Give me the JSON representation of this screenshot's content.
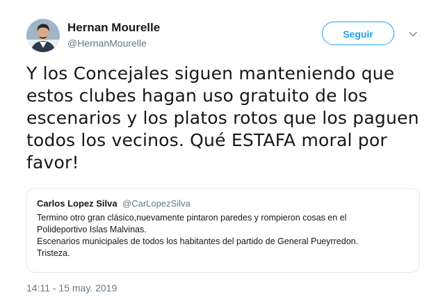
{
  "author": {
    "name": "Hernan Mourelle",
    "handle": "@HernanMourelle",
    "avatar_icon": "profile-photo"
  },
  "follow_button": {
    "label": "Seguir",
    "color": "#1da1f2"
  },
  "menu_icon": "chevron-down-icon",
  "tweet": {
    "text": "Y los Concejales siguen manteniendo que estos clubes hagan uso gratuito de los escenarios y los platos rotos que los paguen todos los vecinos. Qué ESTAFA moral por favor!",
    "timestamp": "14:11 - 15 may. 2019"
  },
  "quoted_tweet": {
    "name": "Carlos Lopez Silva",
    "handle": "@CarLopezSilva",
    "lines": [
      "Termino otro gran clásico,nuevamente pintaron paredes y rompieron cosas en el",
      "Polideportivo Islas Malvinas.",
      "Escenarios municipales de todos los habitantes del partido de General Pueyrredon.",
      "Tristeza."
    ]
  }
}
